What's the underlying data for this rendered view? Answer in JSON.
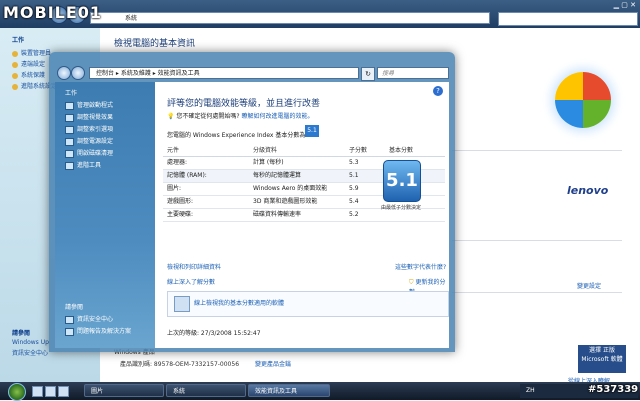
{
  "watermark": {
    "brand": "MOBILE01",
    "post_id": "#537339"
  },
  "background_window": {
    "address_path": "系統",
    "search_placeholder": "",
    "heading": "檢視電腦的基本資訊",
    "sidebar_head": "工作",
    "sidebar_items": [
      "裝置管理員",
      "遠端設定",
      "系統保護",
      "進階系統設定"
    ],
    "see_also_head": "請參閱",
    "see_also_items": [
      "Windows Up",
      "資訊安全中心"
    ],
    "product_label": "Windows 產品",
    "product_id": "產品識別碼: 89578-OEM-7332157-00056",
    "change_key": "變更產品金鑰",
    "change_settings": "變更設定",
    "genuine_badge": "選擇 正版 Microsoft 軟體",
    "genuine_link": "從線上深入瞭解"
  },
  "window": {
    "address_path": "控制台 ▸ 系統及維護 ▸ 效能資訊及工具",
    "search_placeholder": "搜尋",
    "sidebar_head": "工作",
    "sidebar_items": [
      "管理啟動程式",
      "調整視覺效果",
      "調整索引選項",
      "調整電源設定",
      "開啟磁碟清理",
      "進階工具"
    ],
    "see_also_head": "請參閱",
    "see_also_items": [
      "資訊安全中心",
      "問題報告及解決方案"
    ],
    "title": "評等您的電腦效能等級，並且進行改善",
    "tip_text": "您不確定從何處開始嗎?",
    "tip_link": "瞭解如何改進電腦的效能。",
    "base_score_text": "您電腦的 Windows Experience Index 基本分數為",
    "base_score_badge": "5.1",
    "table": {
      "headers": [
        "元件",
        "分級資料",
        "子分數",
        "基本分數"
      ],
      "rows": [
        {
          "component": "處理器:",
          "rating": "計算 (每秒)",
          "subscore": "5.3"
        },
        {
          "component": "記憶體 (RAM):",
          "rating": "每秒的記憶體運算",
          "subscore": "5.1"
        },
        {
          "component": "圖片:",
          "rating": "Windows Aero 的桌面效能",
          "subscore": "5.9"
        },
        {
          "component": "遊戲圖形:",
          "rating": "3D 商業和遊戲圖形效能",
          "subscore": "5.4"
        },
        {
          "component": "主要硬碟:",
          "rating": "磁碟資料傳輸速率",
          "subscore": "5.2"
        }
      ]
    },
    "base_score": "5.1",
    "base_score_caption": "由最低子分數決定",
    "link_what": "檢視和列印詳細資料",
    "link_online": "線上深入了解分數",
    "link_print": "這些數字代表什麼?",
    "link_update": "更新我的分數",
    "panel_link": "線上檢視我的基本分數適用的軟體",
    "last_update": "上次的等級: 27/3/2008 15:52:47"
  },
  "taskbar": {
    "items": [
      "圖片",
      "系統",
      "效能資訊及工具"
    ],
    "tray_lang": "ZH"
  }
}
